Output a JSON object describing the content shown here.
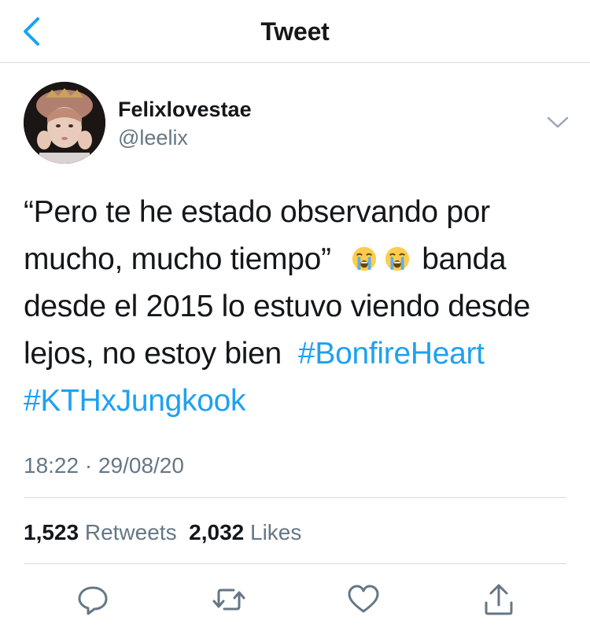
{
  "header": {
    "title": "Tweet",
    "back_icon": "chevron-left-icon"
  },
  "author": {
    "display_name": "Felixlovestae",
    "handle": "@leelix",
    "avatar_icon": "avatar"
  },
  "tweet": {
    "text_part1": "“Pero te he estado observando por mucho, mucho tiempo”",
    "emojis": [
      "loudly-crying-face-icon",
      "loudly-crying-face-icon"
    ],
    "text_part2": "banda desde el 2015 lo estuvo viendo desde lejos, no estoy bien",
    "hashtags": [
      "#BonfireHeart",
      "#KTHxJungkook"
    ]
  },
  "timestamp": "18:22 · 29/08/20",
  "stats": {
    "retweets_count": "1,523",
    "retweets_label": "Retweets",
    "likes_count": "2,032",
    "likes_label": "Likes"
  },
  "actions": [
    "reply-icon",
    "retweet-icon",
    "like-icon",
    "share-icon"
  ],
  "colors": {
    "accent": "#1da1f2",
    "text": "#14171a",
    "secondary": "#657786",
    "divider": "#d6dde2"
  }
}
